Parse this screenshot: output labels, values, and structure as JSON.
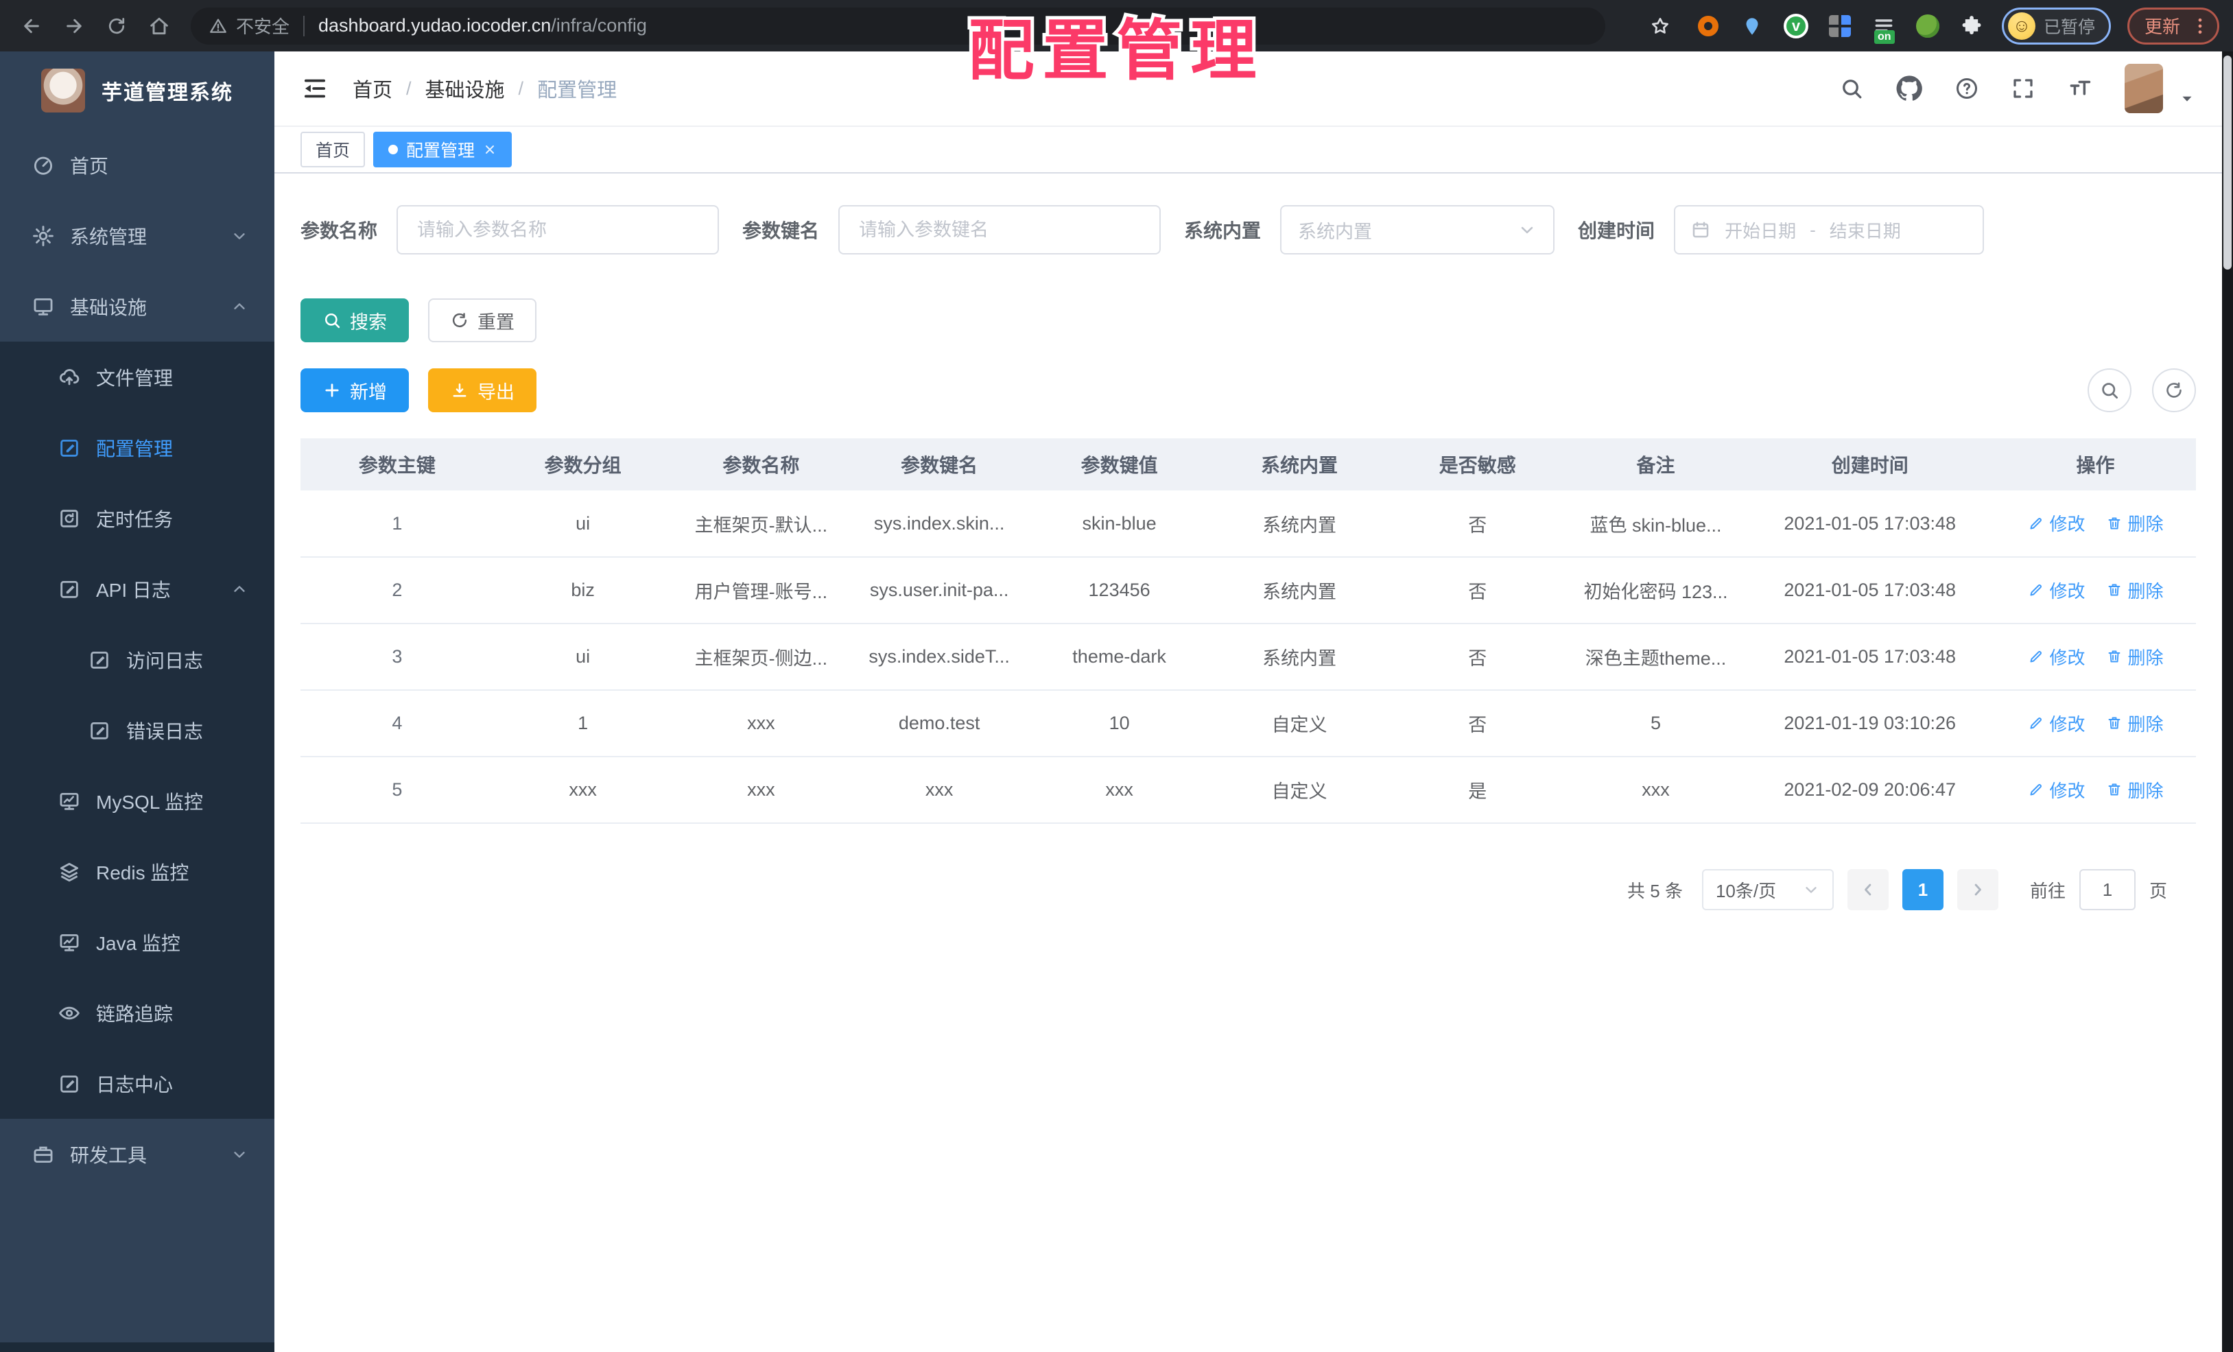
{
  "colors": {
    "accent_blue": "#409EFF",
    "button_blue": "#2196f3",
    "teal": "#2aa79b",
    "amber": "#fbb017",
    "overlay_pink": "#fb3a68",
    "sidebar_bg": "#304156",
    "sidebar_submenu_bg": "#1f2d3d"
  },
  "browser": {
    "security_label": "不安全",
    "url_host": "dashboard.yudao.iocoder.cn",
    "url_path": "/infra/config",
    "ext_badge": "on",
    "ext_v_glyph": "v",
    "profile_emoji": "☺",
    "profile_chip": "已暂停",
    "update_label": "更新"
  },
  "overlay": {
    "title": "配置管理"
  },
  "sidebar": {
    "title": "芋道管理系统",
    "items": [
      {
        "label": "首页",
        "icon": "gauge",
        "level": 0,
        "section": "light"
      },
      {
        "label": "系统管理",
        "icon": "gear",
        "level": 0,
        "section": "light",
        "arrow": "down"
      },
      {
        "label": "基础设施",
        "icon": "monitor",
        "level": 0,
        "section": "light",
        "arrow": "up"
      },
      {
        "label": "文件管理",
        "icon": "cloud-up",
        "level": 1,
        "section": "dark"
      },
      {
        "label": "配置管理",
        "icon": "edit-square",
        "level": 1,
        "section": "dark",
        "active": true
      },
      {
        "label": "定时任务",
        "icon": "timer",
        "level": 1,
        "section": "dark"
      },
      {
        "label": "API 日志",
        "icon": "edit-square",
        "level": 1,
        "section": "dark",
        "arrow": "up"
      },
      {
        "label": "访问日志",
        "icon": "edit-square",
        "level": 2,
        "section": "dark"
      },
      {
        "label": "错误日志",
        "icon": "edit-square",
        "level": 2,
        "section": "dark"
      },
      {
        "label": "MySQL 监控",
        "icon": "screen",
        "level": 1,
        "section": "dark"
      },
      {
        "label": "Redis 监控",
        "icon": "layers",
        "level": 1,
        "section": "dark"
      },
      {
        "label": "Java 监控",
        "icon": "screen",
        "level": 1,
        "section": "dark"
      },
      {
        "label": "链路追踪",
        "icon": "eye",
        "level": 1,
        "section": "dark"
      },
      {
        "label": "日志中心",
        "icon": "edit-square",
        "level": 1,
        "section": "dark"
      },
      {
        "label": "研发工具",
        "icon": "briefcase",
        "level": 0,
        "section": "light",
        "arrow": "down"
      }
    ]
  },
  "header": {
    "breadcrumb": [
      "首页",
      "基础设施",
      "配置管理"
    ]
  },
  "tags": [
    {
      "label": "首页",
      "active": false
    },
    {
      "label": "配置管理",
      "active": true,
      "closable": true
    }
  ],
  "filters": {
    "name_label": "参数名称",
    "name_placeholder": "请输入参数名称",
    "key_label": "参数键名",
    "key_placeholder": "请输入参数键名",
    "type_label": "系统内置",
    "type_placeholder": "系统内置",
    "date_label": "创建时间",
    "date_start_placeholder": "开始日期",
    "date_separator": "-",
    "date_end_placeholder": "结束日期",
    "search_label": "搜索",
    "reset_label": "重置"
  },
  "toolbar": {
    "add_label": "新增",
    "export_label": "导出"
  },
  "table": {
    "headers": [
      "参数主键",
      "参数分组",
      "参数名称",
      "参数键名",
      "参数键值",
      "系统内置",
      "是否敏感",
      "备注",
      "创建时间",
      "操作"
    ],
    "rows": [
      [
        "1",
        "ui",
        "主框架页-默认...",
        "sys.index.skin...",
        "skin-blue",
        "系统内置",
        "否",
        "蓝色 skin-blue...",
        "2021-01-05 17:03:48"
      ],
      [
        "2",
        "biz",
        "用户管理-账号...",
        "sys.user.init-pa...",
        "123456",
        "系统内置",
        "否",
        "初始化密码 123...",
        "2021-01-05 17:03:48"
      ],
      [
        "3",
        "ui",
        "主框架页-侧边...",
        "sys.index.sideT...",
        "theme-dark",
        "系统内置",
        "否",
        "深色主题theme...",
        "2021-01-05 17:03:48"
      ],
      [
        "4",
        "1",
        "xxx",
        "demo.test",
        "10",
        "自定义",
        "否",
        "5",
        "2021-01-19 03:10:26"
      ],
      [
        "5",
        "xxx",
        "xxx",
        "xxx",
        "xxx",
        "自定义",
        "是",
        "xxx",
        "2021-02-09 20:06:47"
      ]
    ],
    "action_edit": "修改",
    "action_delete": "删除"
  },
  "pagination": {
    "total": "共 5 条",
    "page_size": "10条/页",
    "current_page": "1",
    "goto_label": "前往",
    "goto_value": "1",
    "page_unit": "页"
  }
}
